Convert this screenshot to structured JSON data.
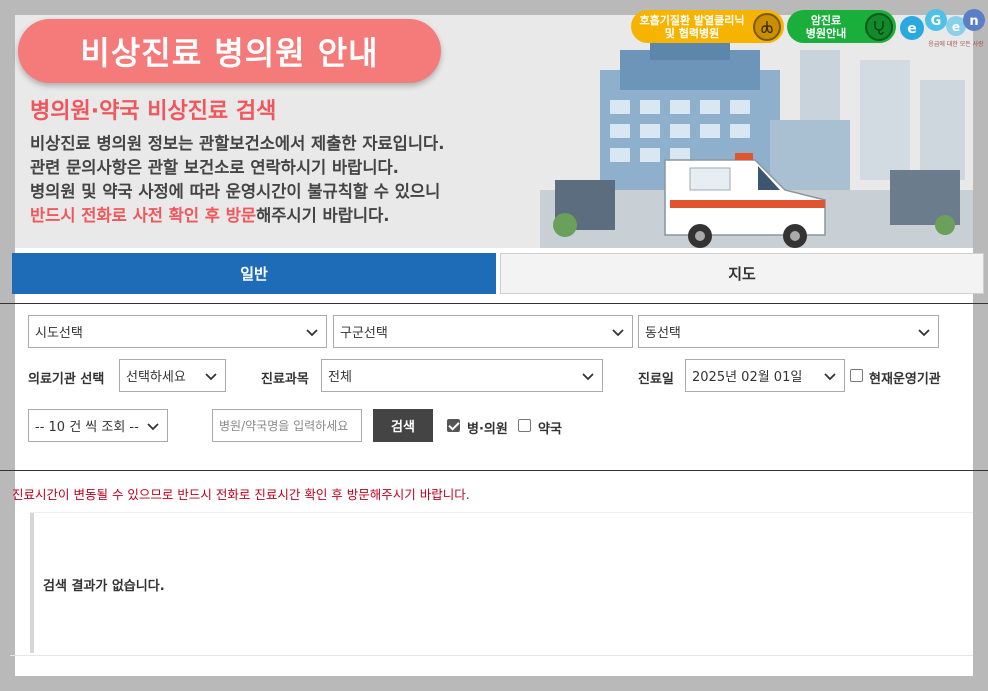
{
  "header": {
    "title": "비상진료 병의원 안내",
    "subtitle": "병의원·약국 비상진료 검색",
    "desc_line1": "비상진료 병의원 정보는 관할보건소에서 제출한 자료입니다.",
    "desc_line2": "관련 문의사항은 관할 보건소로 연락하시기 바랍니다.",
    "desc_line3": "병의원 및 약국 사정에 따라 운영시간이 불규칙할 수 있으니",
    "desc_line4_highlight": "반드시 전화로 사전 확인 후 방문",
    "desc_line4_rest": "해주시기 바랍니다.",
    "btn_respiratory_line1": "호흡기질환 발열클리닉",
    "btn_respiratory_line2": "및 협력병원",
    "btn_cancer_line1": "암진료",
    "btn_cancer_line2": "병원안내",
    "logo_text": "e-Gen",
    "logo_tagline": "응급에 대한 모든 사랑"
  },
  "tabs": [
    {
      "label": "일반",
      "active": true
    },
    {
      "label": "지도",
      "active": false
    }
  ],
  "filters": {
    "sido": "시도선택",
    "gugun": "구군선택",
    "dong": "동선택",
    "inst_label": "의료기관 선택",
    "inst_value": "선택하세요",
    "dept_label": "진료과목",
    "dept_value": "전체",
    "date_label": "진료일",
    "date_value": "2025년 02월 01일",
    "operating_label": "현재운영기관",
    "page_size": "-- 10 건 씩 조회 --",
    "name_placeholder": "병원/약국명을 입력하세요",
    "search_label": "검색",
    "hospital_label": "병·의원",
    "pharmacy_label": "약국"
  },
  "notice": "진료시간이 변동될 수 있으므로 반드시 전화로 진료시간 확인 후 방문해주시기 바랍니다.",
  "result": {
    "empty_text": "검색 결과가 없습니다."
  },
  "colors": {
    "primary": "#1e6cb8",
    "accent": "#f0575d",
    "notice": "#c0001c",
    "yellow": "#f6b400",
    "green": "#1aae3b"
  }
}
